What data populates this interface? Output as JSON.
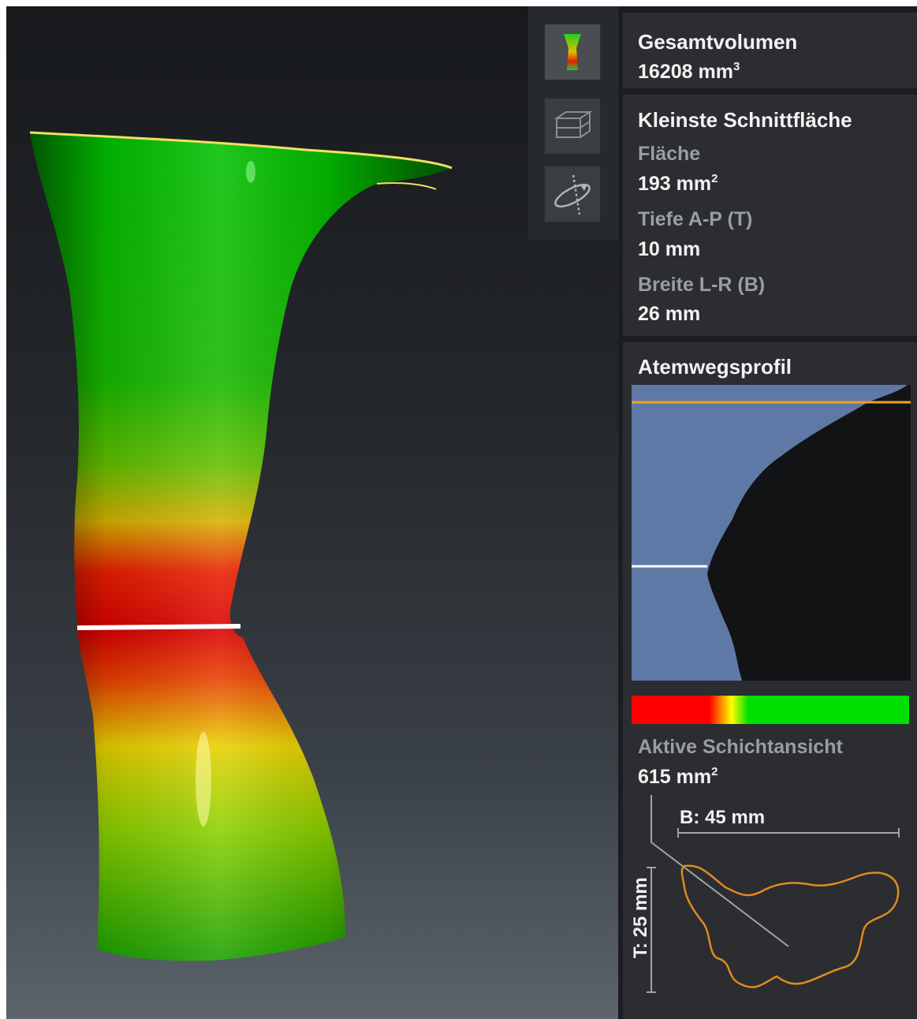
{
  "volume": {
    "title": "Gesamtvolumen",
    "value": "16208 mm",
    "unit_exp": "3"
  },
  "smallest_section": {
    "title": "Kleinste Schnittfläche",
    "area_label": "Fläche",
    "area_value": "193 mm",
    "area_exp": "2",
    "depth_label": "Tiefe A-P (T)",
    "depth_value": "10 mm",
    "width_label": "Breite L-R (B)",
    "width_value": "26 mm"
  },
  "profile": {
    "title": "Atemwegsprofil",
    "active_label": "Aktive Schichtansicht",
    "active_value": "615 mm",
    "active_exp": "2",
    "width_measure": "B: 45 mm",
    "depth_measure": "T: 25 mm",
    "colors": {
      "profile_fill": "#5f79a6",
      "top_marker": "#f0a020",
      "narrow_marker": "#ffffff",
      "contour": "#e08a20",
      "scale_low": "#ff0000",
      "scale_mid": "#ffff00",
      "scale_high": "#00e000"
    }
  },
  "toolbar": {
    "icons": [
      "airway-color-icon",
      "section-box-icon",
      "rotate-plane-icon"
    ]
  }
}
